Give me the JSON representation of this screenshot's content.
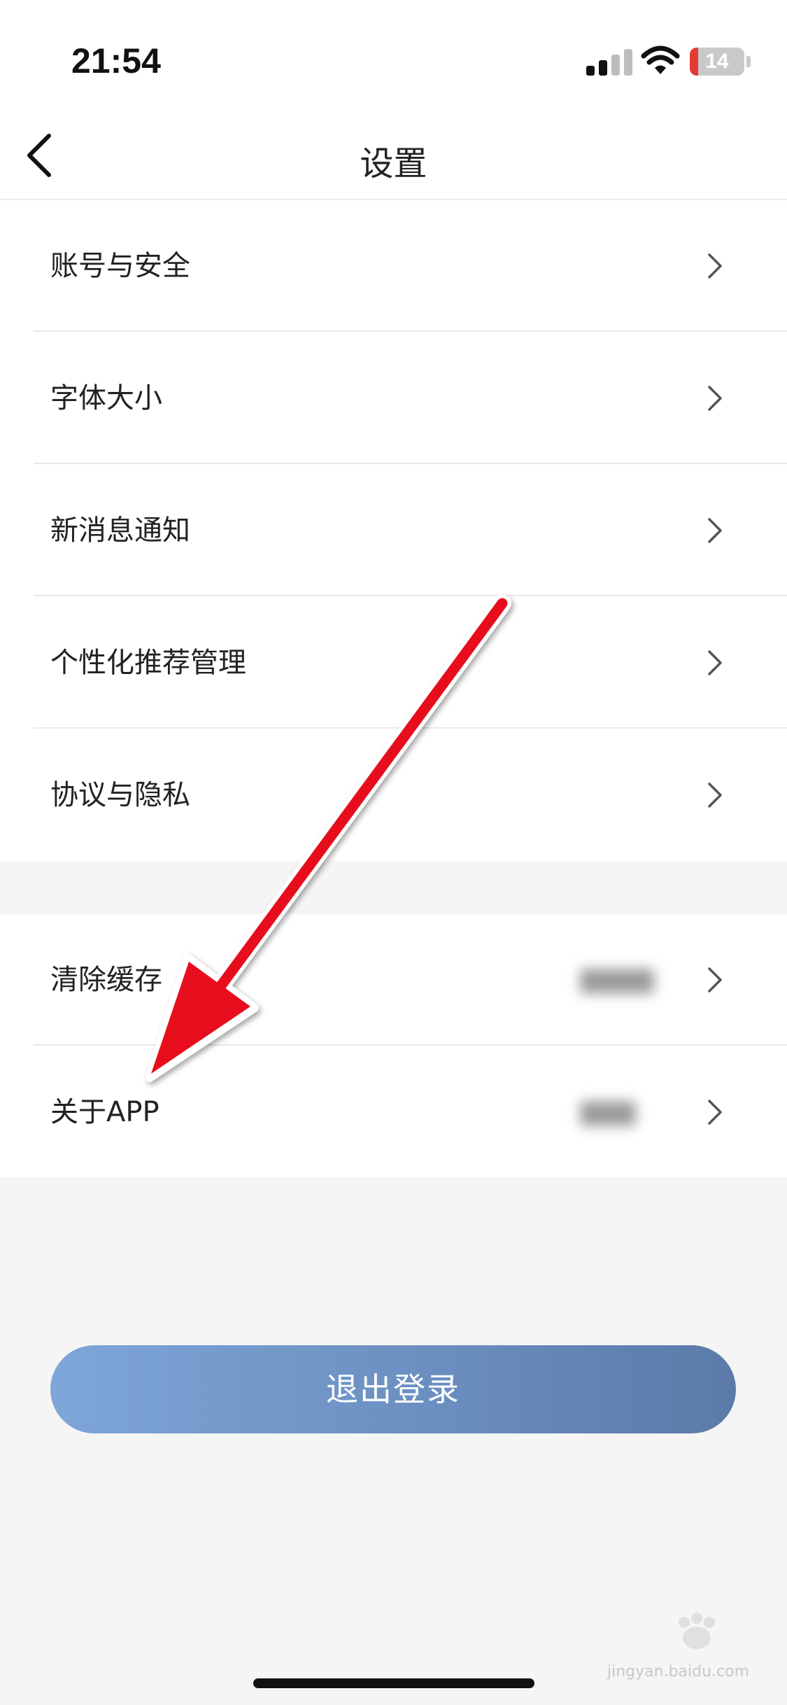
{
  "status_bar": {
    "time": "21:54",
    "battery_level": "14"
  },
  "nav": {
    "title": "设置",
    "back_icon": "chevron-left-icon"
  },
  "settings_group_1": [
    {
      "label": "账号与安全"
    },
    {
      "label": "字体大小"
    },
    {
      "label": "新消息通知"
    },
    {
      "label": "个性化推荐管理"
    },
    {
      "label": "协议与隐私"
    }
  ],
  "settings_group_2": [
    {
      "label": "清除缓存"
    },
    {
      "label": "关于APP"
    }
  ],
  "logout_button": {
    "label": "退出登录"
  },
  "watermark": {
    "text": "jingyan.baidu.com"
  },
  "colors": {
    "arrow": "#e8111a",
    "button_start": "#7ea6d8",
    "button_end": "#5b7aa8"
  }
}
